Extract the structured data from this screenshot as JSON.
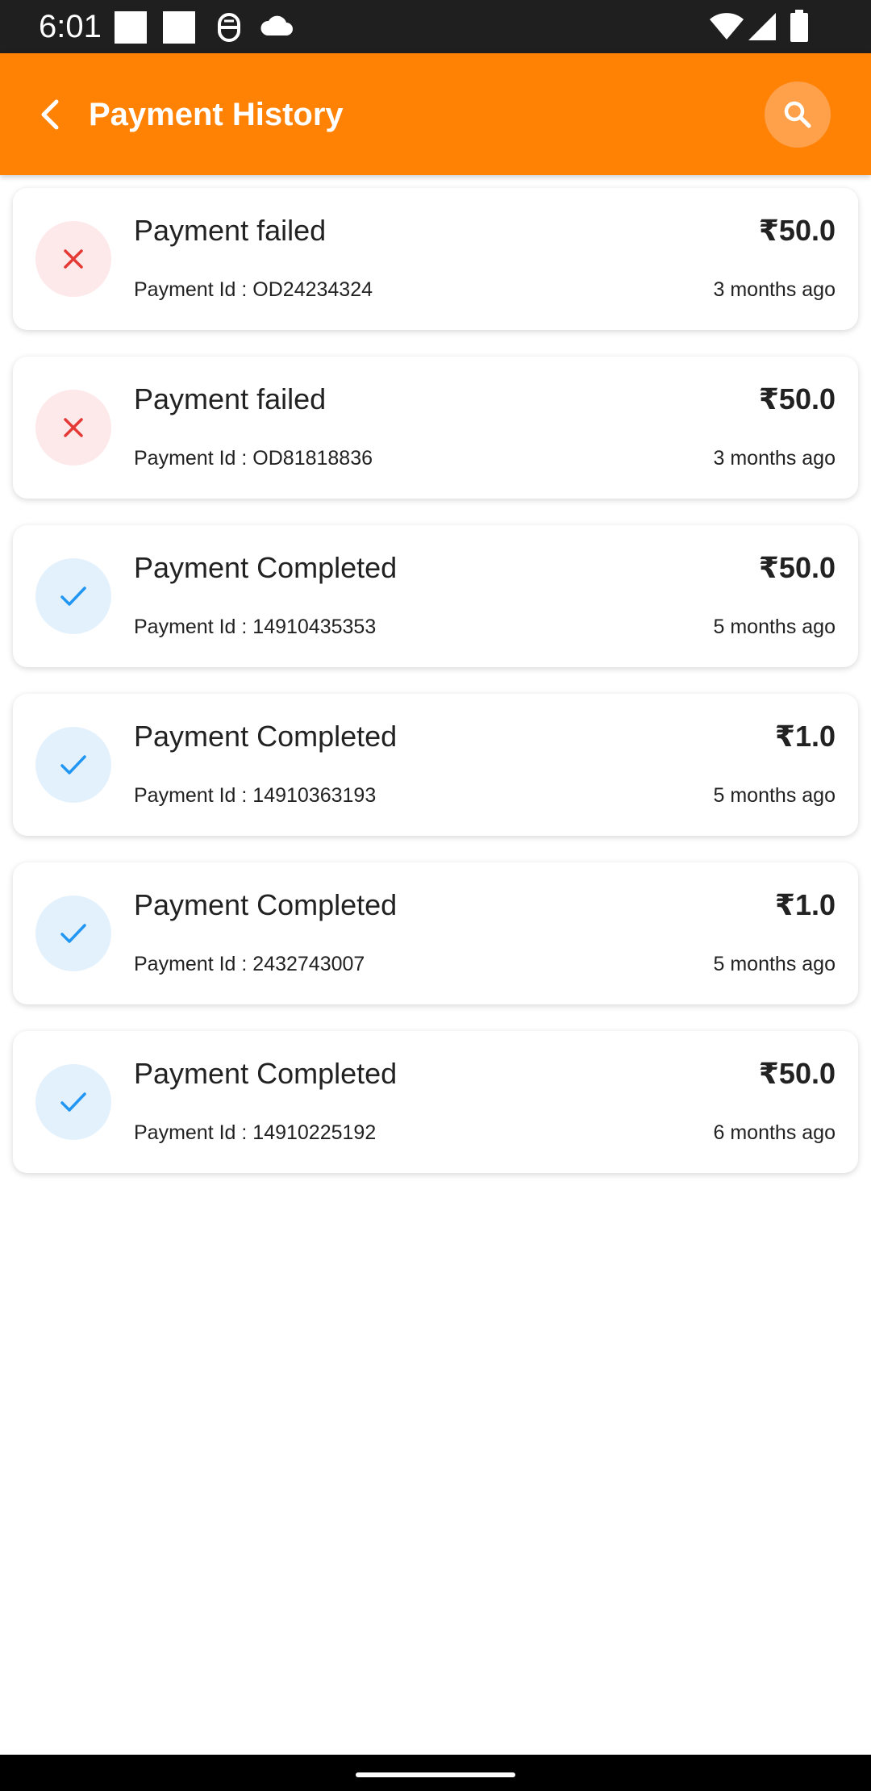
{
  "status_bar": {
    "time": "6:01",
    "icons": [
      "notification-square-icon",
      "notification-square-icon",
      "accessibility-icon",
      "cloud-icon",
      "wifi-icon",
      "cellular-signal-icon",
      "battery-icon"
    ]
  },
  "app_bar": {
    "title": "Payment History",
    "back_icon": "back-arrow-icon",
    "search_icon": "search-icon",
    "color": "#ff8205"
  },
  "payments": [
    {
      "status": "failed",
      "title": "Payment failed",
      "amount": "₹50.0",
      "payment_id": "Payment Id : OD24234324",
      "time": "3 months ago"
    },
    {
      "status": "failed",
      "title": "Payment failed",
      "amount": "₹50.0",
      "payment_id": "Payment Id : OD81818836",
      "time": "3 months ago"
    },
    {
      "status": "completed",
      "title": "Payment Completed",
      "amount": "₹50.0",
      "payment_id": "Payment Id : 14910435353",
      "time": "5 months ago"
    },
    {
      "status": "completed",
      "title": "Payment Completed",
      "amount": "₹1.0",
      "payment_id": "Payment Id : 14910363193",
      "time": "5 months ago"
    },
    {
      "status": "completed",
      "title": "Payment Completed",
      "amount": "₹1.0",
      "payment_id": "Payment Id : 2432743007",
      "time": "5 months ago"
    },
    {
      "status": "completed",
      "title": "Payment Completed",
      "amount": "₹50.0",
      "payment_id": "Payment Id : 14910225192",
      "time": "6 months ago"
    }
  ],
  "colors": {
    "failed_icon": "#e53935",
    "failed_bg": "#fde8ea",
    "completed_icon": "#2196f3",
    "completed_bg": "#e3f1fd"
  }
}
